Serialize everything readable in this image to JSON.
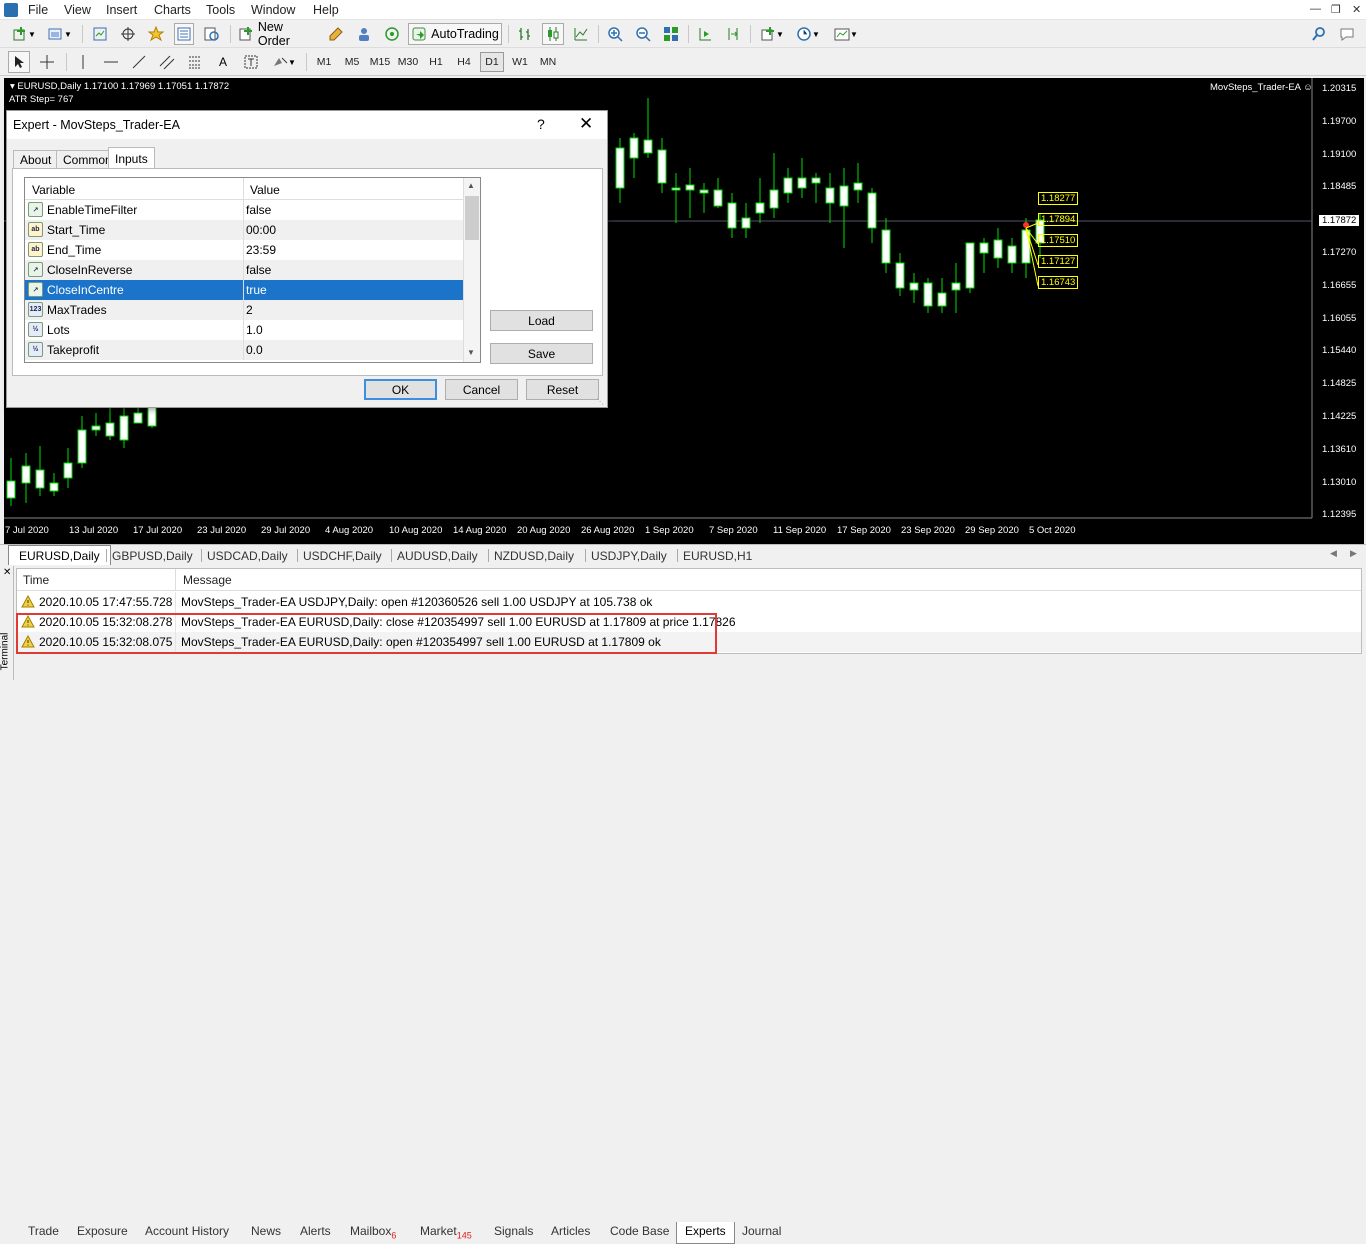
{
  "menu": [
    "File",
    "View",
    "Insert",
    "Charts",
    "Tools",
    "Window",
    "Help"
  ],
  "toolbar": {
    "new_order": "New Order",
    "autotrading": "AutoTrading"
  },
  "timeframes": [
    "M1",
    "M5",
    "M15",
    "M30",
    "H1",
    "H4",
    "D1",
    "W1",
    "MN"
  ],
  "active_timeframe": "D1",
  "chart": {
    "header": "EURUSD,Daily  1.17100 1.17969 1.17051 1.17872",
    "atr_step": "ATR Step= 767",
    "ea_label": "MovSteps_Trader-EA ☺",
    "current_price": "1.17872",
    "price_axis": [
      "1.20315",
      "1.19700",
      "1.19100",
      "1.18485",
      "1.17872",
      "1.17270",
      "1.16655",
      "1.16055",
      "1.15440",
      "1.14825",
      "1.14225",
      "1.13610",
      "1.13010",
      "1.12395"
    ],
    "date_axis": [
      "7 Jul 2020",
      "13 Jul 2020",
      "17 Jul 2020",
      "23 Jul 2020",
      "29 Jul 2020",
      "4 Aug 2020",
      "10 Aug 2020",
      "14 Aug 2020",
      "20 Aug 2020",
      "26 Aug 2020",
      "1 Sep 2020",
      "7 Sep 2020",
      "11 Sep 2020",
      "17 Sep 2020",
      "23 Sep 2020",
      "29 Sep 2020",
      "5 Oct 2020"
    ],
    "level_labels": [
      "1.18277",
      "1.17894",
      "1.17510",
      "1.17127",
      "1.16743"
    ],
    "colors": {
      "background": "#000000",
      "bull": "#00dd00",
      "label": "#ffff00",
      "grid": "#3a3a3a"
    }
  },
  "symbol_tabs": [
    "EURUSD,Daily",
    "GBPUSD,Daily",
    "USDCAD,Daily",
    "USDCHF,Daily",
    "AUDUSD,Daily",
    "NZDUSD,Daily",
    "USDJPY,Daily",
    "EURUSD,H1"
  ],
  "active_symbol_tab": "EURUSD,Daily",
  "dialog": {
    "title": "Expert - MovSteps_Trader-EA",
    "help": "?",
    "tabs": [
      "About",
      "Common",
      "Inputs"
    ],
    "active_tab": "Inputs",
    "columns": {
      "variable": "Variable",
      "value": "Value"
    },
    "inputs": [
      {
        "icon": "bool-icon",
        "name": "EnableTimeFilter",
        "value": "false"
      },
      {
        "icon": "string-icon",
        "name": "Start_Time",
        "value": "00:00"
      },
      {
        "icon": "string-icon",
        "name": "End_Time",
        "value": "23:59"
      },
      {
        "icon": "bool-icon",
        "name": "CloseInReverse",
        "value": "false"
      },
      {
        "icon": "bool-icon",
        "name": "CloseInCentre",
        "value": "true"
      },
      {
        "icon": "int-icon",
        "name": "MaxTrades",
        "value": "2"
      },
      {
        "icon": "double-icon",
        "name": "Lots",
        "value": "1.0"
      },
      {
        "icon": "double-icon",
        "name": "Takeprofit",
        "value": "0.0"
      }
    ],
    "selected_input": "CloseInCentre",
    "buttons": {
      "load": "Load",
      "save": "Save",
      "ok": "OK",
      "cancel": "Cancel",
      "reset": "Reset"
    }
  },
  "terminal": {
    "side_label": "Terminal",
    "columns": {
      "time": "Time",
      "message": "Message"
    },
    "rows": [
      {
        "time": "2020.10.05 17:47:55.728",
        "message": "MovSteps_Trader-EA USDJPY,Daily: open #120360526 sell 1.00 USDJPY at 105.738 ok"
      },
      {
        "time": "2020.10.05 15:32:08.278",
        "message": "MovSteps_Trader-EA EURUSD,Daily: close #120354997 sell 1.00 EURUSD at 1.17809 at price 1.17826"
      },
      {
        "time": "2020.10.05 15:32:08.075",
        "message": "MovSteps_Trader-EA EURUSD,Daily: open #120354997 sell 1.00 EURUSD at 1.17809 ok"
      }
    ],
    "tabs": [
      {
        "label": "Trade",
        "badge": ""
      },
      {
        "label": "Exposure",
        "badge": ""
      },
      {
        "label": "Account History",
        "badge": ""
      },
      {
        "label": "News",
        "badge": ""
      },
      {
        "label": "Alerts",
        "badge": ""
      },
      {
        "label": "Mailbox",
        "badge": "6"
      },
      {
        "label": "Market",
        "badge": "145"
      },
      {
        "label": "Signals",
        "badge": ""
      },
      {
        "label": "Articles",
        "badge": ""
      },
      {
        "label": "Code Base",
        "badge": ""
      },
      {
        "label": "Experts",
        "badge": ""
      },
      {
        "label": "Journal",
        "badge": ""
      }
    ],
    "active_tab": "Experts",
    "highlight_color": "#e03a35"
  }
}
